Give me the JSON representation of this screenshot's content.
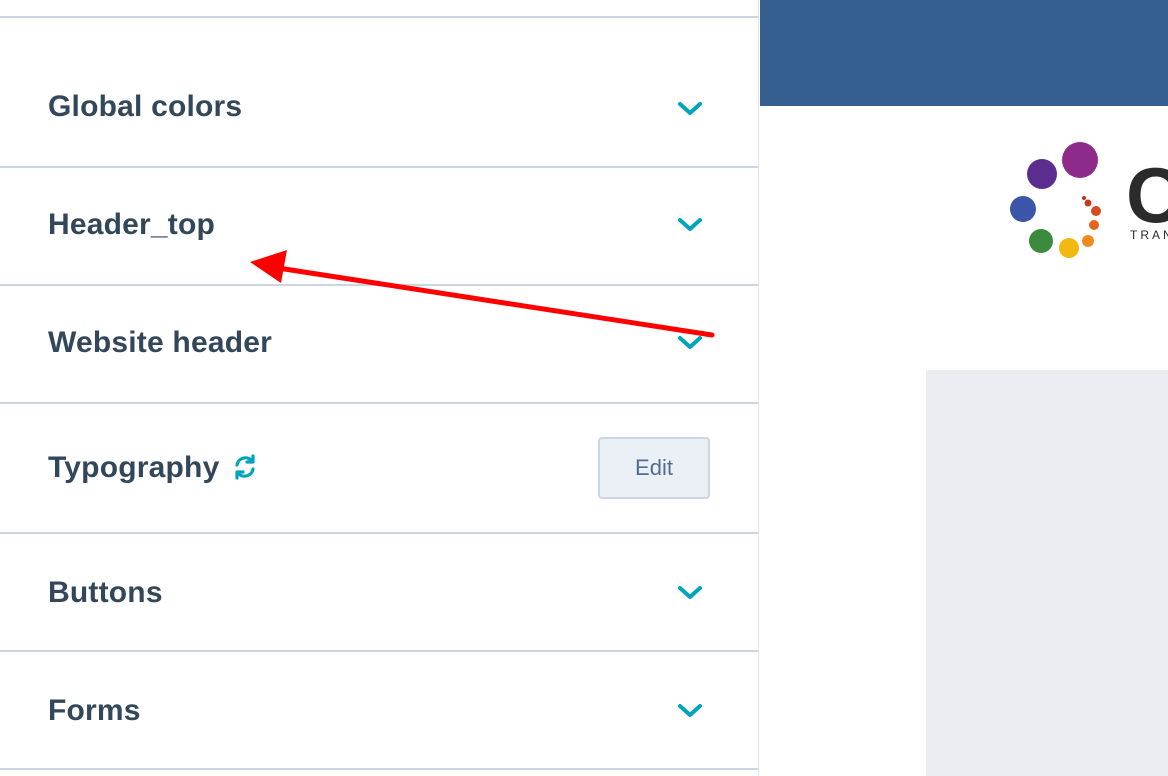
{
  "sections": [
    {
      "label": "Global colors",
      "control": "chevron"
    },
    {
      "label": "Header_top",
      "control": "chevron"
    },
    {
      "label": "Website header",
      "control": "chevron"
    },
    {
      "label": "Typography",
      "control": "edit-button",
      "edit_label": "Edit"
    },
    {
      "label": "Buttons",
      "control": "chevron"
    },
    {
      "label": "Forms",
      "control": "chevron"
    }
  ],
  "icons": {
    "chevron": "chevron-down-icon",
    "sync": "sync-icon",
    "annotation": "red-arrow"
  },
  "preview": {
    "logo_letter": "C",
    "logo_tagline": "TRAN"
  },
  "colors": {
    "panel_text": "#33475b",
    "accent_teal": "#00a4bd",
    "divider": "#cbd6e2",
    "edit_button_bg": "#eaf0f6",
    "edit_button_text": "#506e91",
    "preview_header": "#355f8e",
    "preview_content_bg": "#eaedf2",
    "annotation_red": "#ff0000"
  }
}
